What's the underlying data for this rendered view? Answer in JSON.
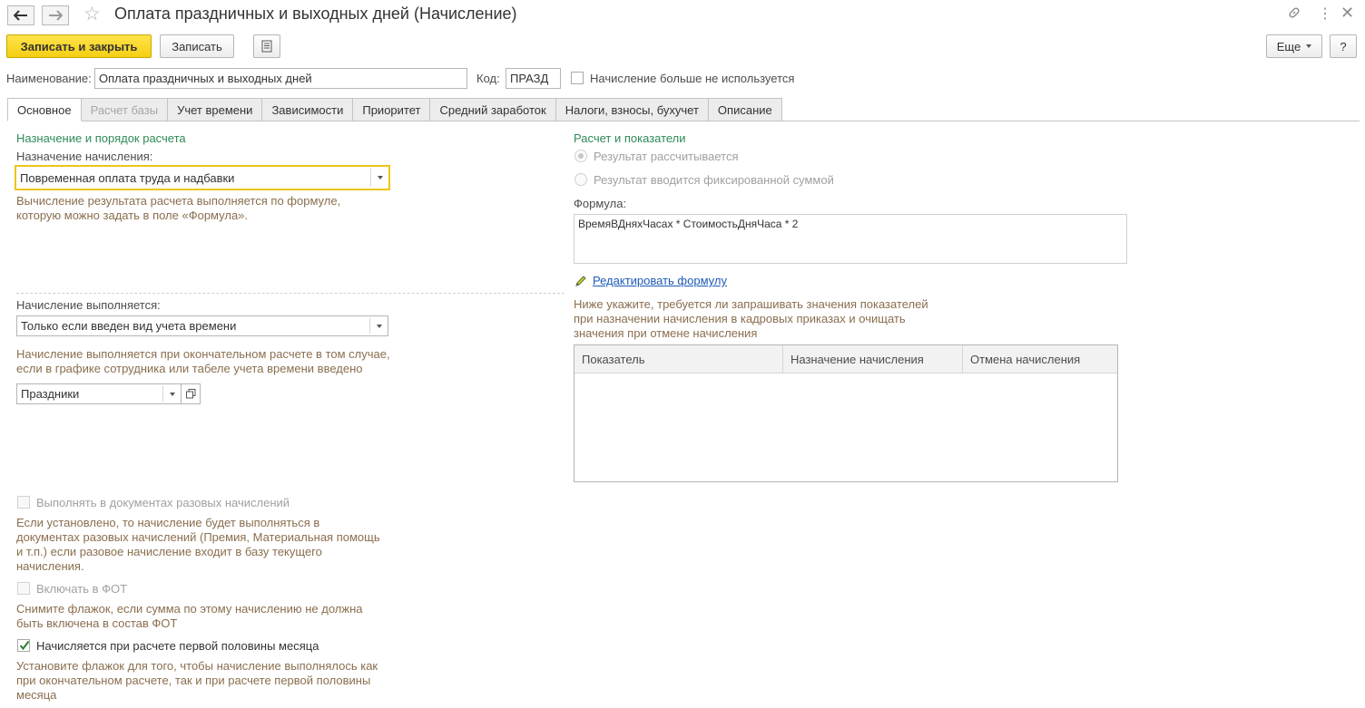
{
  "window": {
    "title": "Оплата праздничных и выходных дней (Начисление)"
  },
  "toolbar": {
    "save_close_label": "Записать и закрыть",
    "save_label": "Записать",
    "more_label": "Еще",
    "help_label": "?"
  },
  "header": {
    "name_label": "Наименование:",
    "name_value": "Оплата праздничных и выходных дней",
    "code_label": "Код:",
    "code_value": "ПРАЗД",
    "unused_label": "Начисление больше не используется"
  },
  "tabs": [
    {
      "label": "Основное",
      "state": "active"
    },
    {
      "label": "Расчет базы",
      "state": "disabled"
    },
    {
      "label": "Учет времени",
      "state": "normal"
    },
    {
      "label": "Зависимости",
      "state": "normal"
    },
    {
      "label": "Приоритет",
      "state": "normal"
    },
    {
      "label": "Средний заработок",
      "state": "normal"
    },
    {
      "label": "Налоги, взносы, бухучет",
      "state": "normal"
    },
    {
      "label": "Описание",
      "state": "normal"
    }
  ],
  "left": {
    "group_title": "Назначение и порядок расчета",
    "purpose_label": "Назначение начисления:",
    "purpose_value": "Повременная оплата труда и надбавки",
    "purpose_hint": "Вычисление результата расчета выполняется по формуле, которую можно задать в поле «Формула».",
    "execution_label": "Начисление выполняется:",
    "execution_value": "Только если введен вид учета времени",
    "execution_hint": "Начисление выполняется при окончательном расчете в том случае, если в графике сотрудника или табеле учета времени введено",
    "time_kind_value": "Праздники",
    "onetime_label": "Выполнять в документах разовых начислений",
    "onetime_hint": "Если установлено, то начисление будет выполняться в документах разовых начислений (Премия, Материальная помощь и т.п.) если разовое начисление входит в базу текущего начисления.",
    "fot_label": "Включать в ФОТ",
    "fot_hint": "Снимите флажок, если сумма по этому начислению не должна быть включена в состав ФОТ",
    "first_half_label": "Начисляется при расчете первой половины месяца",
    "first_half_checked": true,
    "first_half_hint": "Установите флажок для того, чтобы начисление выполнялось как при окончательном расчете, так и при расчете первой половины месяца"
  },
  "right": {
    "group_title": "Расчет и показатели",
    "radio_calculated": "Результат рассчитывается",
    "radio_fixed": "Результат вводится фиксированной суммой",
    "formula_label": "Формула:",
    "formula_value": "ВремяВДняхЧасах * СтоимостьДняЧаса * 2",
    "edit_formula_link": "Редактировать формулу",
    "indicators_hint": "Ниже укажите, требуется ли запрашивать значения показателей при назначении начисления в кадровых приказах и очищать значения при отмене начисления",
    "table_columns": [
      "Показатель",
      "Назначение начисления",
      "Отмена начисления"
    ]
  },
  "icons": {
    "back": "arrow-left-icon",
    "forward": "arrow-right-icon",
    "favorite": "star-icon",
    "link": "link-icon",
    "menu": "kebab-menu-icon",
    "close": "close-icon",
    "report": "document-list-icon",
    "pencil": "pencil-icon",
    "open": "open-form-icon"
  },
  "colors": {
    "primary_button": "#f5cf12",
    "group_title": "#2e8b57",
    "hint_text": "#8a6e4e",
    "link": "#1c5ab5",
    "focus_border": "#f0c419"
  }
}
